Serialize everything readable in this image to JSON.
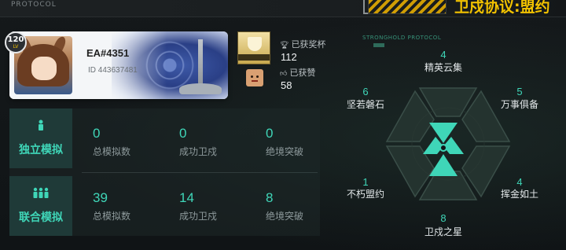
{
  "header": {
    "small_label": "PROTOCOL",
    "title": "卫戍协议:盟约"
  },
  "profile": {
    "level": "120",
    "level_suffix": "LV",
    "name": "EA#4351",
    "id_text": "ID 443637481"
  },
  "achievements": {
    "trophy_label": "已获奖杯",
    "trophy_count": "112",
    "likes_label": "已获赞",
    "likes_count": "58"
  },
  "stats": {
    "rows": [
      {
        "label": "独立模拟",
        "cells": [
          {
            "value": "0",
            "label": "总模拟数"
          },
          {
            "value": "0",
            "label": "成功卫戍"
          },
          {
            "value": "0",
            "label": "绝境突破"
          }
        ]
      },
      {
        "label": "联合模拟",
        "cells": [
          {
            "value": "39",
            "label": "总模拟数"
          },
          {
            "value": "14",
            "label": "成功卫戍"
          },
          {
            "value": "8",
            "label": "绝境突破"
          }
        ]
      }
    ]
  },
  "protocol": {
    "caption": "STRONGHOLD PROTOCOL",
    "nodes": [
      {
        "value": "4",
        "label": "精英云集"
      },
      {
        "value": "5",
        "label": "万事俱备"
      },
      {
        "value": "4",
        "label": "挥金如土"
      },
      {
        "value": "8",
        "label": "卫戍之星"
      },
      {
        "value": "1",
        "label": "不朽盟约"
      },
      {
        "value": "6",
        "label": "坚若磐石"
      }
    ]
  },
  "colors": {
    "accent_teal": "#3fd6b8",
    "title_yellow": "#f2c200"
  }
}
